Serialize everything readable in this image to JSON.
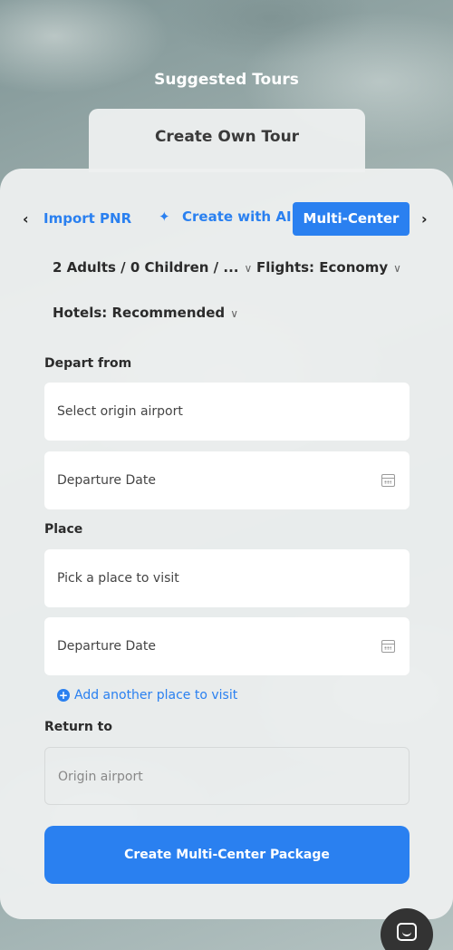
{
  "header": {
    "title": "Suggested Tours"
  },
  "main_tab": {
    "label": "Create Own Tour"
  },
  "mode_tabs": {
    "prev_icon": "chevron-left-icon",
    "import_pnr": "Import PNR",
    "create_ai": "Create with AI",
    "ai_icon": "sparkle-icon",
    "multi_center": "Multi-Center",
    "next_icon": "chevron-right-icon"
  },
  "filters": {
    "travelers": "2 Adults / 0 Children / ...",
    "flights": "Flights: Economy",
    "hotels": "Hotels: Recommended"
  },
  "form": {
    "depart_label": "Depart from",
    "origin_placeholder": "Select origin airport",
    "departure_date_placeholder": "Departure Date",
    "place_label": "Place",
    "place_placeholder": "Pick a place to visit",
    "place_date_placeholder": "Departure Date",
    "add_place": "Add another place to visit",
    "return_label": "Return to",
    "return_placeholder": "Origin airport"
  },
  "cta": {
    "label": "Create Multi-Center Package"
  },
  "colors": {
    "accent": "#2a80f0",
    "panel": "#eef0f0",
    "fab": "#333333"
  }
}
